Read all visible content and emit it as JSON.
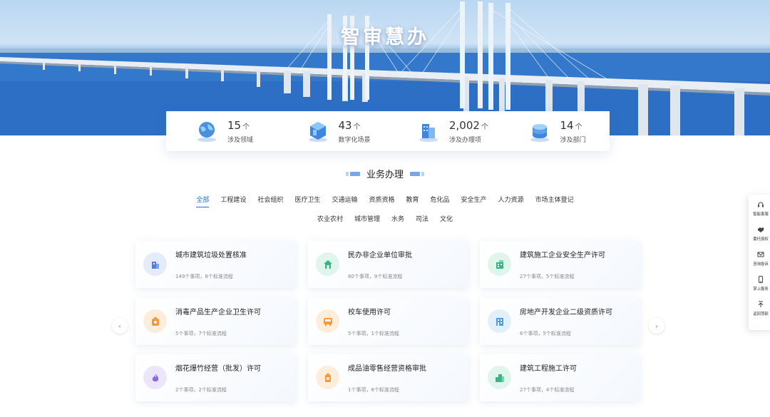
{
  "hero": {
    "title": "智审慧办"
  },
  "stats": [
    {
      "value": "15",
      "unit": "个",
      "label": "涉及领域",
      "icon": "globe-icon"
    },
    {
      "value": "43",
      "unit": "个",
      "label": "数字化场景",
      "icon": "cube-icon"
    },
    {
      "value": "2,002",
      "unit": "个",
      "label": "涉及办理项",
      "icon": "building-icon"
    },
    {
      "value": "14",
      "unit": "个",
      "label": "涉及部门",
      "icon": "database-icon"
    }
  ],
  "section": {
    "title": "业务办理"
  },
  "tabs_row1": [
    "全部",
    "工程建设",
    "社会组织",
    "医疗卫生",
    "交通运输",
    "资质资格",
    "教育",
    "危化品",
    "安全生产",
    "人力资源",
    "市场主体登记"
  ],
  "tabs_row2": [
    "农业农村",
    "城市管理",
    "水务",
    "司法",
    "文化"
  ],
  "active_tab": "全部",
  "cards": [
    {
      "title": "城市建筑垃圾处置核准",
      "meta": "149个事项，8个标准流程",
      "icon": "building-icon",
      "color": "#4e7ee8"
    },
    {
      "title": "民办非企业单位审批",
      "meta": "80个事项，9个标准流程",
      "icon": "house-icon",
      "color": "#35b887"
    },
    {
      "title": "建筑施工企业安全生产许可",
      "meta": "27个事项，5个标准流程",
      "icon": "construction-icon",
      "color": "#35b887"
    },
    {
      "title": "消毒产品生产企业卫生许可",
      "meta": "5个事项，7个标准流程",
      "icon": "bottle-icon",
      "color": "#f59a3c"
    },
    {
      "title": "校车使用许可",
      "meta": "5个事项，1个标准流程",
      "icon": "bus-icon",
      "color": "#f59a3c"
    },
    {
      "title": "房地产开发企业二级资质许可",
      "meta": "6个事项，5个标准流程",
      "icon": "office-icon",
      "color": "#4e9de8"
    },
    {
      "title": "烟花爆竹经营（批发）许可",
      "meta": "2个事项，2个标准流程",
      "icon": "flame-icon",
      "color": "#8a6ae0"
    },
    {
      "title": "成品油零售经营资格审批",
      "meta": "1个事项，6个标准流程",
      "icon": "fuel-can-icon",
      "color": "#f59a3c"
    },
    {
      "title": "建筑工程施工许可",
      "meta": "27个事项，4个标准流程",
      "icon": "city-icon",
      "color": "#35b887"
    }
  ],
  "float_menu": [
    {
      "label": "智能客服",
      "icon": "headset-icon"
    },
    {
      "label": "委托授权",
      "icon": "handshake-icon"
    },
    {
      "label": "咨询投诉",
      "icon": "mail-icon"
    },
    {
      "label": "掌上服务",
      "icon": "mobile-icon"
    },
    {
      "label": "返回顶部",
      "icon": "back-to-top-icon"
    }
  ],
  "arrows": {
    "prev": "‹",
    "next": "›"
  }
}
